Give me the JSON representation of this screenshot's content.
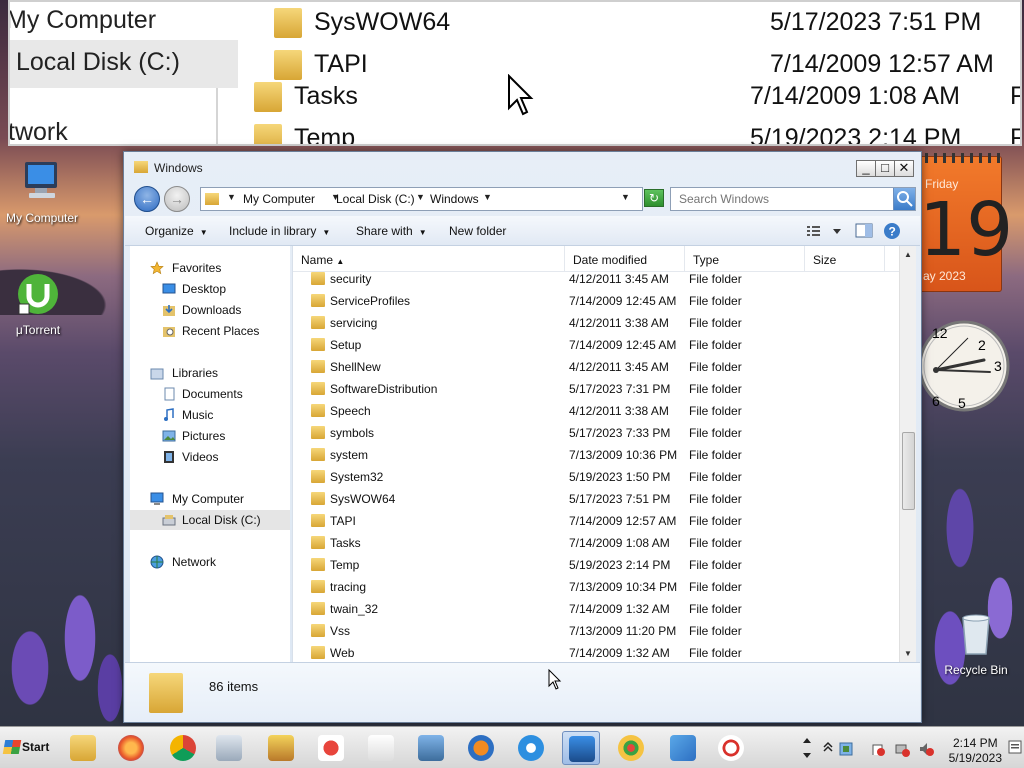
{
  "magnifier": {
    "left_items": [
      "My Computer",
      "Local Disk (C:)",
      "twork"
    ],
    "rows": [
      {
        "name": "SysWOW64",
        "date": "5/17/2023 7:51 PM",
        "type": ""
      },
      {
        "name": "TAPI",
        "date": "7/14/2009 12:57 AM",
        "type": ""
      },
      {
        "name": "Tasks",
        "date": "7/14/2009 1:08 AM",
        "type": "Fi"
      },
      {
        "name": "Temp",
        "date": "5/19/2023 2:14 PM",
        "type": "Fi"
      }
    ]
  },
  "desktop": {
    "icons": [
      "My Computer",
      "μTorrent",
      "Recycle Bin"
    ],
    "calendar": {
      "dow": "Friday",
      "day": "19",
      "month_year": "ay 2023"
    },
    "clock_numbers": [
      "12",
      "2",
      "3",
      "5",
      "6"
    ]
  },
  "window": {
    "title": "Windows",
    "buttons": {
      "minimize": "_",
      "maximize": "□",
      "close": "✕"
    },
    "address": {
      "crumbs": [
        "My Computer",
        "Local Disk (C:)",
        "Windows"
      ]
    },
    "search": {
      "placeholder": "Search Windows"
    },
    "toolbar": {
      "organize": "Organize",
      "include": "Include in library",
      "share": "Share with",
      "new_folder": "New folder"
    },
    "nav": {
      "favorites": "Favorites",
      "desktop": "Desktop",
      "downloads": "Downloads",
      "recent": "Recent Places",
      "libraries": "Libraries",
      "documents": "Documents",
      "music": "Music",
      "pictures": "Pictures",
      "videos": "Videos",
      "my_computer": "My Computer",
      "local_disk": "Local Disk (C:)",
      "network": "Network"
    },
    "columns": {
      "name": "Name",
      "date": "Date modified",
      "type": "Type",
      "size": "Size"
    },
    "files": [
      {
        "name": "security",
        "date": "4/12/2011 3:45 AM",
        "type": "File folder"
      },
      {
        "name": "ServiceProfiles",
        "date": "7/14/2009 12:45 AM",
        "type": "File folder"
      },
      {
        "name": "servicing",
        "date": "4/12/2011 3:38 AM",
        "type": "File folder"
      },
      {
        "name": "Setup",
        "date": "7/14/2009 12:45 AM",
        "type": "File folder"
      },
      {
        "name": "ShellNew",
        "date": "4/12/2011 3:45 AM",
        "type": "File folder"
      },
      {
        "name": "SoftwareDistribution",
        "date": "5/17/2023 7:31 PM",
        "type": "File folder"
      },
      {
        "name": "Speech",
        "date": "4/12/2011 3:38 AM",
        "type": "File folder"
      },
      {
        "name": "symbols",
        "date": "5/17/2023 7:33 PM",
        "type": "File folder"
      },
      {
        "name": "system",
        "date": "7/13/2009 10:36 PM",
        "type": "File folder"
      },
      {
        "name": "System32",
        "date": "5/19/2023 1:50 PM",
        "type": "File folder"
      },
      {
        "name": "SysWOW64",
        "date": "5/17/2023 7:51 PM",
        "type": "File folder"
      },
      {
        "name": "TAPI",
        "date": "7/14/2009 12:57 AM",
        "type": "File folder"
      },
      {
        "name": "Tasks",
        "date": "7/14/2009 1:08 AM",
        "type": "File folder"
      },
      {
        "name": "Temp",
        "date": "5/19/2023 2:14 PM",
        "type": "File folder"
      },
      {
        "name": "tracing",
        "date": "7/13/2009 10:34 PM",
        "type": "File folder"
      },
      {
        "name": "twain_32",
        "date": "7/14/2009 1:32 AM",
        "type": "File folder"
      },
      {
        "name": "Vss",
        "date": "7/13/2009 11:20 PM",
        "type": "File folder"
      },
      {
        "name": "Web",
        "date": "7/14/2009 1:32 AM",
        "type": "File folder"
      }
    ],
    "status": {
      "count": "86 items"
    }
  },
  "taskbar": {
    "start": "Start",
    "apps": [
      "file-explorer",
      "firefox",
      "chrome",
      "calculator",
      "solitaire-king",
      "hearts",
      "spider-solitaire",
      "control-panel",
      "media-player",
      "internet-explorer",
      "remote-desktop",
      "paint",
      "send",
      "snipping-tool"
    ],
    "time": "2:14 PM",
    "date": "5/19/2023"
  }
}
